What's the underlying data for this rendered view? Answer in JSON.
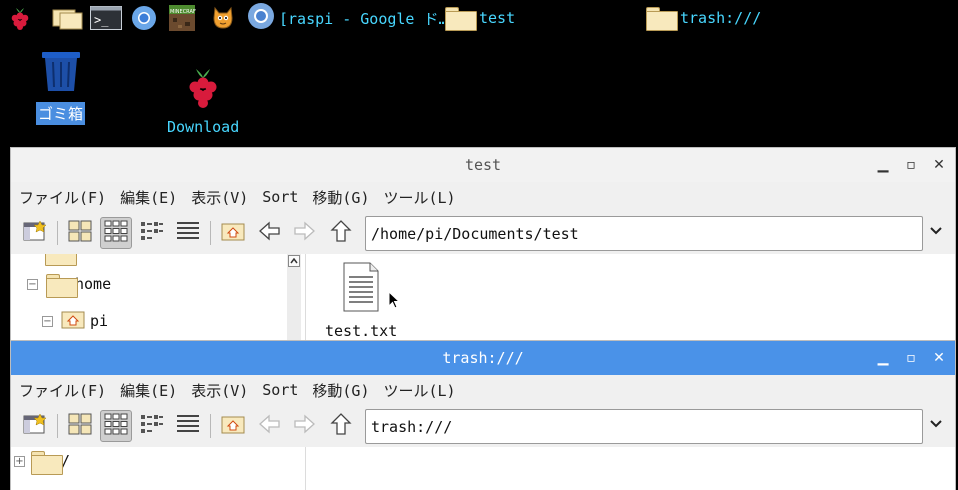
{
  "taskbar": {
    "launchers": [
      {
        "icon": "raspberry-menu-icon"
      },
      {
        "icon": "file-manager-icon"
      },
      {
        "icon": "terminal-icon"
      },
      {
        "icon": "chromium-icon"
      },
      {
        "icon": "minecraft-icon"
      },
      {
        "icon": "scratch-icon"
      }
    ],
    "tasks": [
      {
        "icon": "chromium-icon",
        "label": "[raspi - Google ド…"
      },
      {
        "icon": "folder-icon",
        "label": "test"
      },
      {
        "icon": "folder-icon",
        "label": "trash:///"
      }
    ]
  },
  "desktop": {
    "trash_label": "ゴミ箱",
    "download_label": "Download"
  },
  "win_test": {
    "title": "test",
    "menus": [
      "ファイル(F)",
      "編集(E)",
      "表示(V)",
      "Sort",
      "移動(G)",
      "ツール(L)"
    ],
    "address": "/home/pi/Documents/test",
    "tree": {
      "home": "home",
      "pi": "pi"
    },
    "files": [
      {
        "name": "test.txt",
        "icon": "text-file-icon"
      }
    ]
  },
  "win_trash": {
    "title": "trash:///",
    "menus": [
      "ファイル(F)",
      "編集(E)",
      "表示(V)",
      "Sort",
      "移動(G)",
      "ツール(L)"
    ],
    "address": "trash:///",
    "tree": {
      "root": "/"
    }
  },
  "colors": {
    "taskbar_text": "#48d7ff",
    "active_title": "#4a92e8",
    "selection": "#4a8ee0"
  }
}
